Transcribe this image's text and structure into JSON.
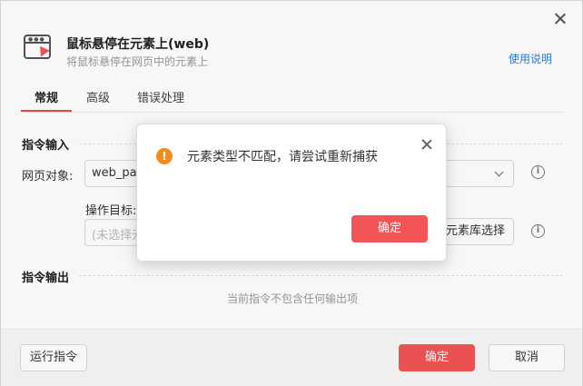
{
  "header": {
    "title": "鼠标悬停在元素上(web)",
    "subtitle": "将鼠标悬停在网页中的元素上",
    "help_link": "使用说明"
  },
  "tabs": [
    {
      "label": "常规",
      "active": true
    },
    {
      "label": "高级",
      "active": false
    },
    {
      "label": "错误处理",
      "active": false
    }
  ],
  "input_section": {
    "title": "指令输入",
    "web_object": {
      "label": "网页对象:",
      "value": "web_pag"
    },
    "target": {
      "label": "操作目标:",
      "placeholder": "(未选择元",
      "library_button": "元素库选择"
    }
  },
  "output_section": {
    "title": "指令输出",
    "empty_text": "当前指令不包含任何输出项"
  },
  "footer": {
    "run_button": "运行指令",
    "confirm_button": "确定",
    "cancel_button": "取消"
  },
  "alert": {
    "message": "元素类型不匹配，请尝试重新捕获",
    "confirm_button": "确定"
  },
  "colors": {
    "accent": "#f25555",
    "link": "#2f7bd8",
    "warning": "#f28c1e"
  },
  "icons": {
    "warning": "exclamation-circle-icon",
    "info": "info-icon",
    "close": "close-icon",
    "dropdown": "chevron-down-icon",
    "header": "mouse-hover-web-icon"
  }
}
